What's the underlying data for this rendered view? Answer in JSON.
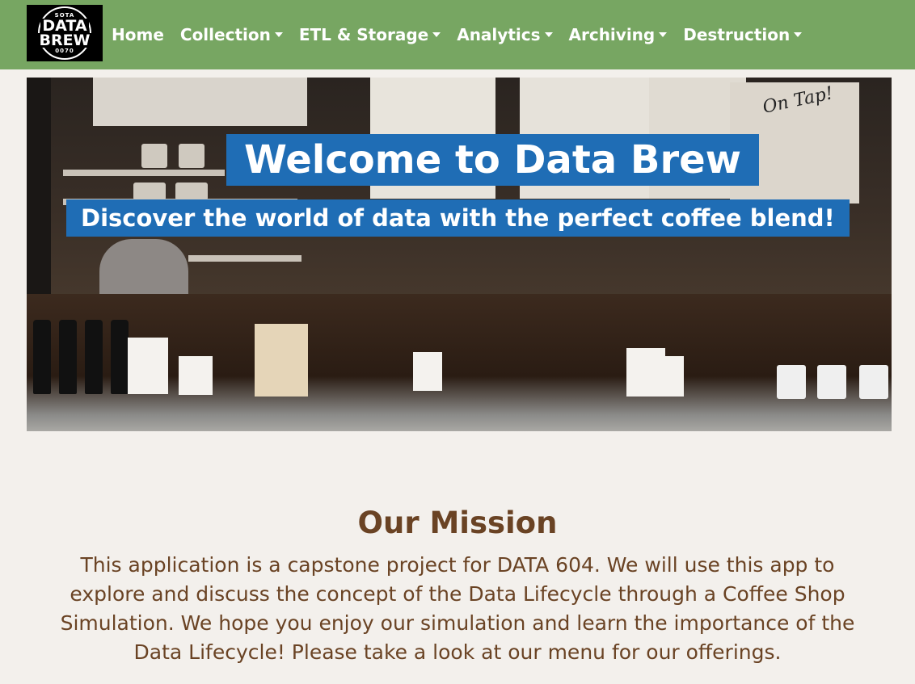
{
  "brand": {
    "logo_top": "SOTA",
    "logo_line1": "DATA",
    "logo_line2": "BREW",
    "logo_bottom": "0070"
  },
  "nav": {
    "items": [
      {
        "label": "Home",
        "dropdown": false
      },
      {
        "label": "Collection",
        "dropdown": true
      },
      {
        "label": "ETL & Storage",
        "dropdown": true
      },
      {
        "label": "Analytics",
        "dropdown": true
      },
      {
        "label": "Archiving",
        "dropdown": true
      },
      {
        "label": "Destruction",
        "dropdown": true
      }
    ]
  },
  "hero": {
    "title": "Welcome to Data Brew",
    "subtitle": "Discover the world of data with the perfect coffee blend!",
    "sign_text": "On Tap!"
  },
  "mission": {
    "title": "Our Mission",
    "text": "This application is a capstone project for DATA 604. We will use this app to explore and discuss the concept of the Data Lifecycle through a Coffee Shop Simulation. We hope you enjoy our simulation and learn the importance of the Data Lifecycle! Please take a look at our menu for our offerings."
  },
  "colors": {
    "navbar": "#77a662",
    "hero_banner": "#1f6db5",
    "mission_text": "#6a4324",
    "page_bg": "#f3f0ec"
  }
}
